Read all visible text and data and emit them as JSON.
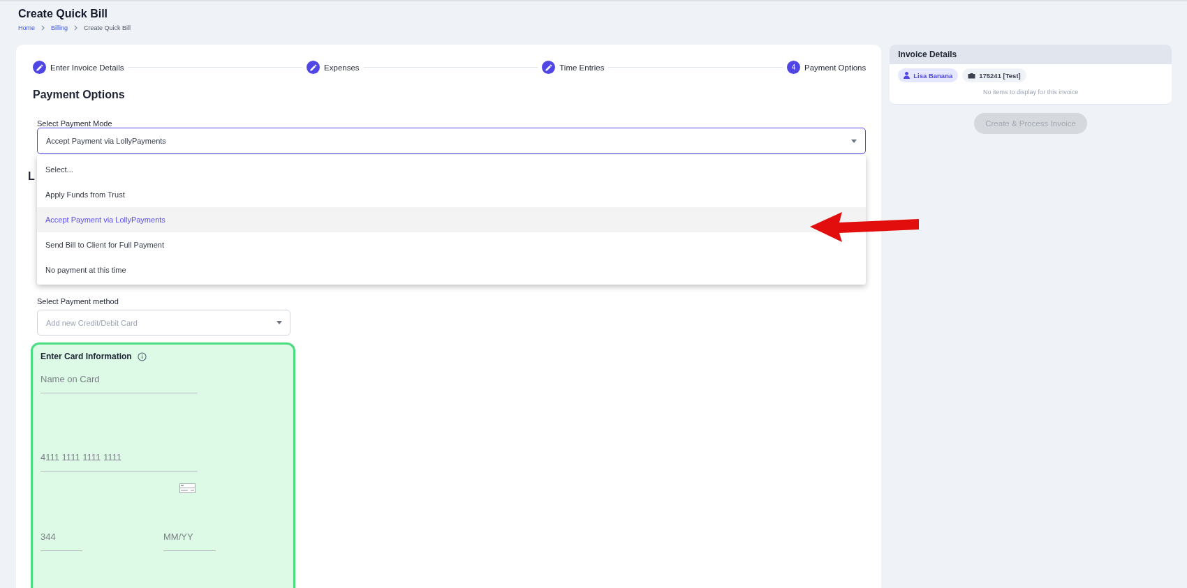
{
  "page": {
    "title": "Create Quick Bill",
    "breadcrumbs": [
      {
        "label": "Home",
        "kind": "link"
      },
      {
        "label": "Billing",
        "kind": "link"
      },
      {
        "label": "Create Quick Bill",
        "kind": "current"
      }
    ]
  },
  "stepper": [
    {
      "label": "Enter Invoice Details",
      "kind": "done"
    },
    {
      "label": "Expenses",
      "kind": "done"
    },
    {
      "label": "Time Entries",
      "kind": "done"
    },
    {
      "label": "Payment Options",
      "kind": "current",
      "number": "4"
    }
  ],
  "payment_options": {
    "heading": "Payment Options",
    "mode_label": "Select Payment Mode",
    "mode_value": "Accept Payment via LollyPayments",
    "hidden_heading": "L",
    "menu": [
      {
        "label": "Select...",
        "selected": false
      },
      {
        "label": "Apply Funds from Trust",
        "selected": false
      },
      {
        "label": "Accept Payment via LollyPayments",
        "selected": true
      },
      {
        "label": "Send Bill to Client for Full Payment",
        "selected": false
      },
      {
        "label": "No payment at this time",
        "selected": false
      }
    ],
    "method_label": "Select Payment method",
    "method_placeholder": "Add new Credit/Debit Card"
  },
  "card_info": {
    "title": "Enter Card Information",
    "fields": [
      {
        "placeholder": "Name on Card"
      },
      {
        "placeholder": "4111 1111 1111 1111"
      },
      {
        "placeholder": "344"
      },
      {
        "placeholder": "MM/YY"
      }
    ]
  },
  "invoice_details": {
    "title": "Invoice Details",
    "tags": [
      {
        "label": "Lisa Banana",
        "kind": "person"
      },
      {
        "label": "175241 [Test]",
        "kind": "matter"
      }
    ],
    "empty_message": "No items to display for this invoice",
    "button": {
      "label": "Create & Process Invoice",
      "disabled": true
    }
  }
}
